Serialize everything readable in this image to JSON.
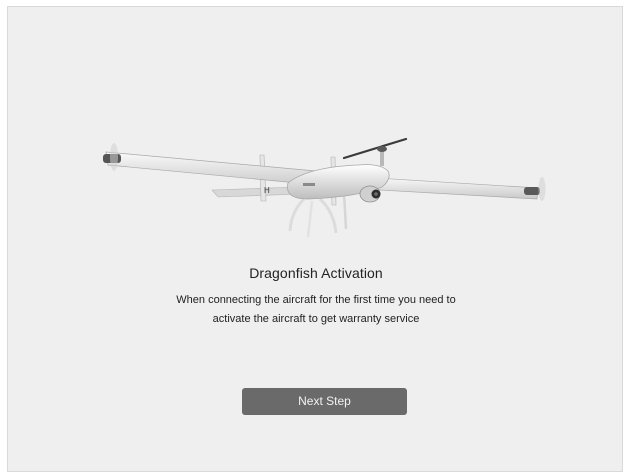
{
  "activation": {
    "title": "Dragonfish Activation",
    "description_line1": "When connecting the aircraft for the first time you need to",
    "description_line2": "activate the aircraft to get warranty service",
    "next_label": "Next Step"
  },
  "illustration": {
    "subject": "Dragonfish VTOL drone",
    "tail_mark": "H"
  },
  "colors": {
    "background": "#efefef",
    "button": "#6a6a6a",
    "button_text": "#f2f2f2",
    "text": "#222222"
  }
}
